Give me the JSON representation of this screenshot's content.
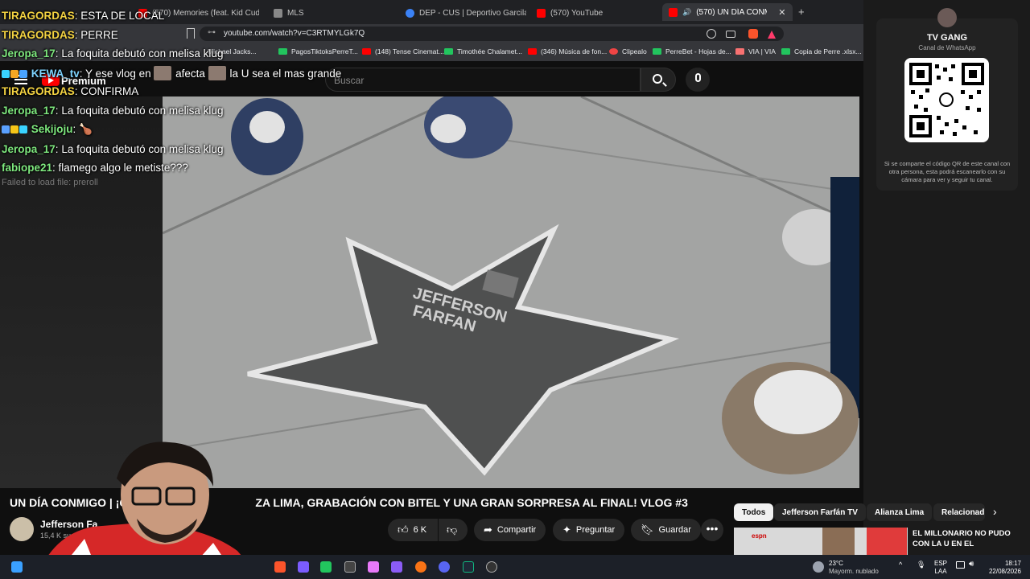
{
  "browser": {
    "tabs": [
      {
        "label": "(570) Memories (feat. Kid Cudi) - You",
        "color": "#ff0000"
      },
      {
        "label": "MLS",
        "color": "#888888"
      },
      {
        "label": "DEP - CUS | Deportivo Garcilaso vs C",
        "color": "#3b82f6"
      },
      {
        "label": "(570) YouTube",
        "color": "#ff0000"
      },
      {
        "label": "(570) UN DÍA CONMIGO | ¡GU",
        "color": "#ff0000"
      }
    ],
    "url": "youtube.com/watch?v=C3RTMYLGk7Q",
    "bookmarks": [
      {
        "label": "Michael Jacks...",
        "color": "#888888"
      },
      {
        "label": "PagosTiktoksPerreT...",
        "color": "#22c55e"
      },
      {
        "label": "(148) Tense Cinemat...",
        "color": "#ff0000"
      },
      {
        "label": "Timothée Chalamet...",
        "color": "#22c55e"
      },
      {
        "label": "(346) Música de fon...",
        "color": "#ff0000"
      },
      {
        "label": "Clipealo",
        "color": "#ef4444"
      },
      {
        "label": "PerreBet - Hojas de...",
        "color": "#22c55e"
      },
      {
        "label": "VIA | VIA",
        "color": "#f87171"
      },
      {
        "label": "Copia de Perre .xlsx...",
        "color": "#22c55e"
      }
    ]
  },
  "youtube": {
    "premium_label": "Premium",
    "search_placeholder": "Buscar",
    "video_title": "UN DÍA CONMIGO | ¡GU",
    "video_title_rest": "ZA LIMA, GRABACIÓN CON BITEL Y UNA GRAN SORPRESA AL FINAL! VLOG #3",
    "channel_name": "Jefferson Fa",
    "subscribers": "15,4 K suscri",
    "likes": "6 K",
    "share_label": "Compartir",
    "ask_label": "Preguntar",
    "save_label": "Guardar",
    "star_text_1": "JEFFERSON",
    "star_text_2": "FARFAN",
    "chips": [
      "Todos",
      "Jefferson Farfán TV",
      "Alianza Lima",
      "Relacionad"
    ],
    "related_title": "EL MILLONARIO NO PUDO CON LA U EN EL",
    "related_badge": "espn"
  },
  "chat": {
    "messages": [
      {
        "user": "TIRAGORDAS",
        "text": "ESTA DE LOCAL",
        "color": "#f5d442"
      },
      {
        "user": "TIRAGORDAS",
        "text": "PERRE",
        "color": "#f5d442"
      },
      {
        "user": "Jeropa_17",
        "text": "La foquita debutó con melisa klug",
        "color": "#7ee87e"
      },
      {
        "user": "KEWA_tv",
        "text": "Y ese vlog en",
        "text2": "afecta",
        "text3": "la U sea el mas grande",
        "color": "#7fd4ff"
      },
      {
        "user": "TIRAGORDAS",
        "text": "CONFIRMA",
        "color": "#f5d442"
      },
      {
        "user": "Jeropa_17",
        "text": "La foquita debutó con melisa klug",
        "color": "#7ee87e"
      },
      {
        "user": "Sekijoju",
        "text": "",
        "color": "#7ee87e"
      },
      {
        "user": "Jeropa_17",
        "text": "La foquita debutó con melisa klug",
        "color": "#7ee87e"
      },
      {
        "user": "fabiope21",
        "text": "flamego algo le metiste???",
        "color": "#7ee87e"
      }
    ],
    "failed_text": "Failed to load file: preroll"
  },
  "whatsapp": {
    "name": "TV GANG",
    "subtitle": "Canal de WhatsApp",
    "description": "Si se comparte el código QR de este canal con otra persona, esta podrá escanearlo con su cámara para ver y seguir tu canal."
  },
  "taskbar": {
    "temperature": "23°C",
    "weather": "Mayorm. nublado",
    "lang1": "ESP",
    "lang2": "LAA",
    "time": "18:17",
    "date": "22/08/2026"
  },
  "colors": {
    "yt_red": "#ff0000",
    "chip_active_bg": "#f1f1f1",
    "background": "#0f0f0f"
  }
}
